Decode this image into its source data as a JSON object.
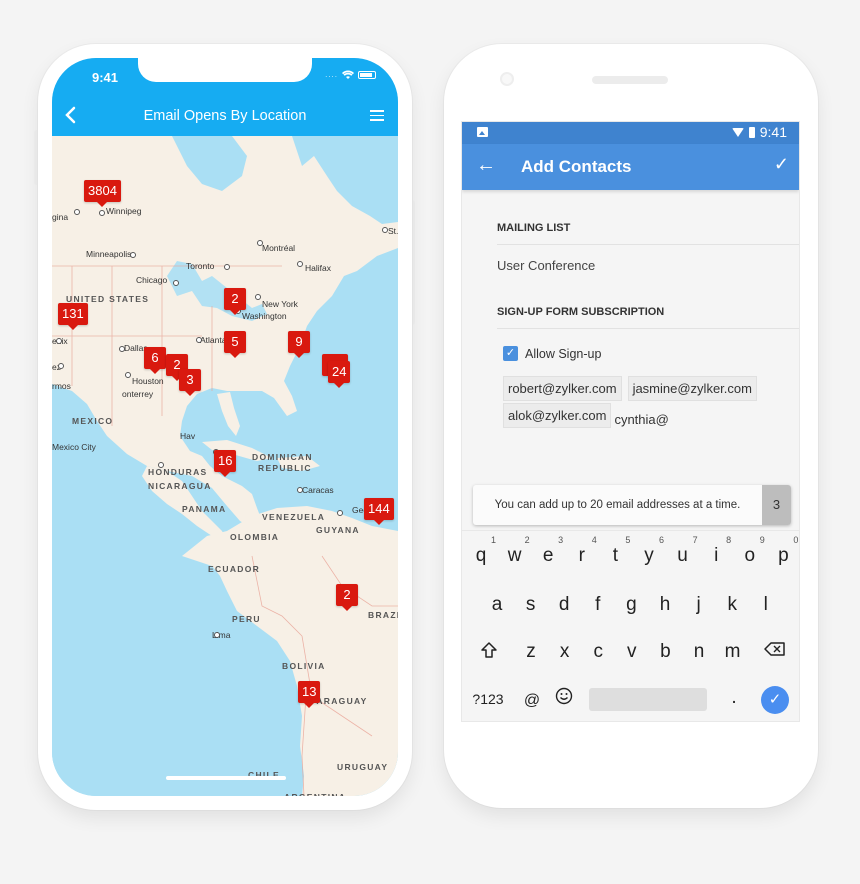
{
  "ios_app": {
    "status_time": "9:41",
    "status_signal": "....",
    "title": "Email Opens By Location",
    "back_icon": "chevron-left-icon",
    "menu_icon": "hamburger-menu-icon",
    "map": {
      "place_labels": [
        {
          "text": "gina",
          "type": "city"
        },
        {
          "text": "Winnipeg",
          "type": "city"
        },
        {
          "text": "Minneapolis",
          "type": "city"
        },
        {
          "text": "Chicago",
          "type": "city"
        },
        {
          "text": "Toronto",
          "type": "city"
        },
        {
          "text": "Montréal",
          "type": "city"
        },
        {
          "text": "Halifax",
          "type": "city"
        },
        {
          "text": "St.",
          "type": "city"
        },
        {
          "text": "New York",
          "type": "city"
        },
        {
          "text": "Washington",
          "type": "city"
        },
        {
          "text": "UNITED STATES",
          "type": "country"
        },
        {
          "text": "enix",
          "type": "city"
        },
        {
          "text": "Dallas",
          "type": "city"
        },
        {
          "text": "Atlanta",
          "type": "city"
        },
        {
          "text": "ez",
          "type": "city"
        },
        {
          "text": "Houston",
          "type": "city"
        },
        {
          "text": "rmos",
          "type": "city"
        },
        {
          "text": "onterrey",
          "type": "city"
        },
        {
          "text": "Hav",
          "type": "city"
        },
        {
          "text": "MEXICO",
          "type": "country"
        },
        {
          "text": "Mexico City",
          "type": "city"
        },
        {
          "text": "DOMINICAN",
          "type": "country"
        },
        {
          "text": "REPUBLIC",
          "type": "country"
        },
        {
          "text": "HONDURAS",
          "type": "country"
        },
        {
          "text": "NICARAGUA",
          "type": "country"
        },
        {
          "text": "Caracas",
          "type": "city"
        },
        {
          "text": "PANAMA",
          "type": "country"
        },
        {
          "text": "VENEZUELA",
          "type": "country"
        },
        {
          "text": "Georgeto",
          "type": "city"
        },
        {
          "text": "OLOMBIA",
          "type": "country"
        },
        {
          "text": "GUYANA",
          "type": "country"
        },
        {
          "text": "ECUADOR",
          "type": "country"
        },
        {
          "text": "PERU",
          "type": "country"
        },
        {
          "text": "BRAZI",
          "type": "country"
        },
        {
          "text": "Lima",
          "type": "city"
        },
        {
          "text": "BOLIVIA",
          "type": "country"
        },
        {
          "text": "PARAGUAY",
          "type": "country"
        },
        {
          "text": "URUGUAY",
          "type": "country"
        },
        {
          "text": "CHILE",
          "type": "country"
        },
        {
          "text": "ARGENTINA",
          "type": "country"
        }
      ],
      "markers": [
        {
          "region": "United States",
          "count": "3804"
        },
        {
          "region": "Mexico",
          "count": "131"
        },
        {
          "region": "Florida / Bahamas",
          "count": "2"
        },
        {
          "region": "Cuba",
          "count": "5"
        },
        {
          "region": "Caribbean north",
          "count": "9"
        },
        {
          "region": "Lesser Antilles (stacked)",
          "count": ""
        },
        {
          "region": "Lesser Antilles",
          "count": "24"
        },
        {
          "region": "Guatemala",
          "count": "6"
        },
        {
          "region": "Belize",
          "count": "2"
        },
        {
          "region": "Honduras",
          "count": "3"
        },
        {
          "region": "Colombia",
          "count": "16"
        },
        {
          "region": "Brazil",
          "count": "144"
        },
        {
          "region": "Paraguay",
          "count": "2"
        },
        {
          "region": "Argentina",
          "count": "13"
        }
      ]
    }
  },
  "android_app": {
    "status_time": "9:41",
    "title": "Add Contacts",
    "back_icon": "arrow-left-icon",
    "confirm_icon": "checkmark-icon",
    "mailing_list": {
      "heading": "MAILING LIST",
      "value": "User Conference"
    },
    "signup": {
      "heading": "SIGN-UP FORM SUBSCRIPTION",
      "checkbox_label": "Allow Sign-up",
      "checked": true
    },
    "email_chips": [
      "robert@zylker.com",
      "jasmine@zylker.com",
      "alok@zylker.com"
    ],
    "email_input_value": "cynthia@",
    "toast": {
      "message": "You can add up to 20 email addresses at a time.",
      "count": "3"
    },
    "keyboard": {
      "row1": [
        {
          "key": "q",
          "hint": "1"
        },
        {
          "key": "w",
          "hint": "2"
        },
        {
          "key": "e",
          "hint": "3"
        },
        {
          "key": "r",
          "hint": "4"
        },
        {
          "key": "t",
          "hint": "5"
        },
        {
          "key": "y",
          "hint": "6"
        },
        {
          "key": "u",
          "hint": "7"
        },
        {
          "key": "i",
          "hint": "8"
        },
        {
          "key": "o",
          "hint": "9"
        },
        {
          "key": "p",
          "hint": "0"
        }
      ],
      "row2": [
        "a",
        "s",
        "d",
        "f",
        "g",
        "h",
        "j",
        "k",
        "l"
      ],
      "row3": [
        "z",
        "x",
        "c",
        "v",
        "b",
        "n",
        "m"
      ],
      "shift_icon": "shift-icon",
      "backspace_icon": "backspace-icon",
      "symbols_label": "?123",
      "at_label": "@",
      "emoji_icon": "emoji-icon",
      "period_label": ".",
      "enter_icon": "checkmark-icon"
    }
  }
}
